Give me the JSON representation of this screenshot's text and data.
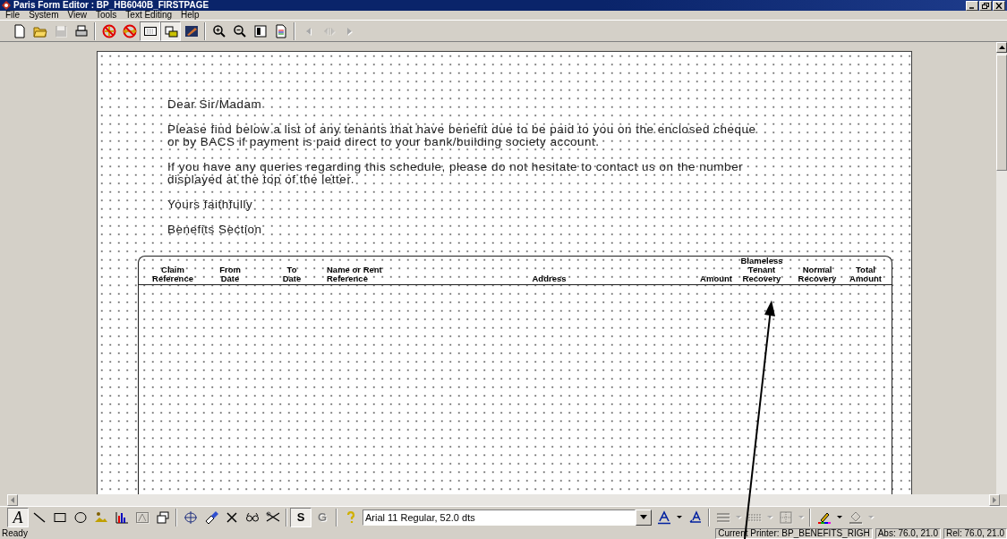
{
  "window": {
    "title": "Paris Form Editor : BP_HB6040B_FIRSTPAGE"
  },
  "menu": [
    "File",
    "System",
    "View",
    "Tools",
    "Text Editing",
    "Help"
  ],
  "toolbar": [
    {
      "kind": "new",
      "pressed": false,
      "disabled": false
    },
    {
      "kind": "open",
      "pressed": false,
      "disabled": false
    },
    {
      "kind": "save",
      "pressed": false,
      "disabled": true
    },
    {
      "kind": "print",
      "pressed": false,
      "disabled": false
    },
    {
      "kind": "separator"
    },
    {
      "kind": "nocross",
      "pressed": false,
      "disabled": false
    },
    {
      "kind": "noarrows",
      "pressed": false,
      "disabled": false
    },
    {
      "kind": "grid",
      "pressed": true,
      "disabled": false
    },
    {
      "kind": "lock",
      "pressed": true,
      "disabled": false
    },
    {
      "kind": "image",
      "pressed": false,
      "disabled": false
    },
    {
      "kind": "separator"
    },
    {
      "kind": "zoomin",
      "pressed": false,
      "disabled": false
    },
    {
      "kind": "zoomout",
      "pressed": false,
      "disabled": false
    },
    {
      "kind": "page",
      "pressed": false,
      "disabled": false
    },
    {
      "kind": "doc",
      "pressed": false,
      "disabled": false
    },
    {
      "kind": "separator"
    },
    {
      "kind": "prev",
      "pressed": false,
      "disabled": true
    },
    {
      "kind": "play",
      "pressed": false,
      "disabled": true
    },
    {
      "kind": "next",
      "pressed": false,
      "disabled": true
    }
  ],
  "letter": {
    "paragraphs": [
      "Dear Sir/Madam",
      "Please find below a list of any tenants that have benefit due to be paid to you on the enclosed cheque or by BACS if payment is paid direct to your bank/building society account.",
      "If you have any queries regarding this schedule, please do not hesitate to contact us on the number displayed at the top of the letter.",
      "Yours faithfully",
      "Benefits Section"
    ]
  },
  "table": {
    "columns": [
      "Claim Reference",
      "From Date",
      "To Date",
      "Name or Rent Reference",
      "Address",
      "Amount",
      "Blameless Tenant Recovery",
      "Normal Recovery",
      "Total Amount"
    ]
  },
  "draw_toolbar": [
    {
      "kind": "textletter",
      "label": "A",
      "pressed": true,
      "disabled": false
    },
    {
      "kind": "line",
      "pressed": false,
      "disabled": false
    },
    {
      "kind": "rect",
      "pressed": false,
      "disabled": false
    },
    {
      "kind": "ellipse",
      "pressed": false,
      "disabled": false
    },
    {
      "kind": "picture",
      "pressed": false,
      "disabled": false
    },
    {
      "kind": "chart",
      "pressed": false,
      "disabled": false
    },
    {
      "kind": "frame",
      "pressed": false,
      "disabled": true
    },
    {
      "kind": "group",
      "pressed": false,
      "disabled": false
    },
    {
      "kind": "separator"
    },
    {
      "kind": "move",
      "pressed": false,
      "disabled": false
    },
    {
      "kind": "eraser",
      "pressed": false,
      "disabled": false
    },
    {
      "kind": "delete",
      "pressed": false,
      "disabled": false
    },
    {
      "kind": "glasses",
      "pressed": false,
      "disabled": false
    },
    {
      "kind": "scissors",
      "pressed": false,
      "disabled": false
    },
    {
      "kind": "separator"
    },
    {
      "kind": "letter",
      "label": "S",
      "pressed": true,
      "disabled": false
    },
    {
      "kind": "letter",
      "label": "G",
      "pressed": false,
      "disabled": true
    },
    {
      "kind": "separator"
    },
    {
      "kind": "help",
      "pressed": false,
      "disabled": false
    },
    {
      "kind": "font",
      "value": "Arial 11 Regular, 52.0 dts"
    },
    {
      "kind": "fontcolor",
      "pressed": false,
      "disabled": false
    },
    {
      "kind": "caret",
      "pressed": false,
      "disabled": false
    },
    {
      "kind": "fontback",
      "pressed": false,
      "disabled": false
    },
    {
      "kind": "separator"
    },
    {
      "kind": "linestyle",
      "pressed": false,
      "disabled": true
    },
    {
      "kind": "caret",
      "pressed": false,
      "disabled": true
    },
    {
      "kind": "dashstyle",
      "pressed": false,
      "disabled": true
    },
    {
      "kind": "caret",
      "pressed": false,
      "disabled": true
    },
    {
      "kind": "border",
      "pressed": false,
      "disabled": true
    },
    {
      "kind": "caret",
      "pressed": false,
      "disabled": true
    },
    {
      "kind": "separator"
    },
    {
      "kind": "pen",
      "pressed": false,
      "disabled": false
    },
    {
      "kind": "caret",
      "pressed": false,
      "disabled": false
    },
    {
      "kind": "fill",
      "pressed": false,
      "disabled": true
    },
    {
      "kind": "caret",
      "pressed": false,
      "disabled": true
    }
  ],
  "status_bar": [
    "Ready",
    "Current Printer: BP_BENEFITS_RIGH",
    "Abs: 76.0, 21.0",
    "Rel: 76.0, 21.0"
  ]
}
